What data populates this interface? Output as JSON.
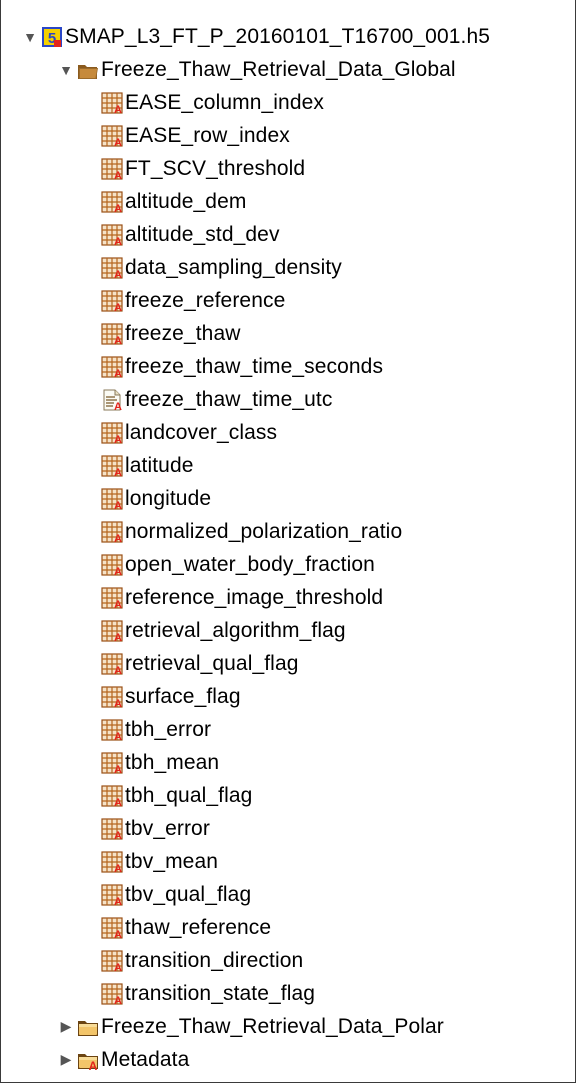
{
  "root": {
    "label": "SMAP_L3_FT_P_20160101_T16700_001.h5",
    "icon": "hdf5-file-icon",
    "expanded": true
  },
  "group_global": {
    "label": "Freeze_Thaw_Retrieval_Data_Global",
    "icon": "folder-open-icon",
    "expanded": true
  },
  "datasets": [
    {
      "label": "EASE_column_index",
      "icon": "dataset-icon"
    },
    {
      "label": "EASE_row_index",
      "icon": "dataset-icon"
    },
    {
      "label": "FT_SCV_threshold",
      "icon": "dataset-icon"
    },
    {
      "label": "altitude_dem",
      "icon": "dataset-icon"
    },
    {
      "label": "altitude_std_dev",
      "icon": "dataset-icon"
    },
    {
      "label": "data_sampling_density",
      "icon": "dataset-icon"
    },
    {
      "label": "freeze_reference",
      "icon": "dataset-icon"
    },
    {
      "label": "freeze_thaw",
      "icon": "dataset-icon"
    },
    {
      "label": "freeze_thaw_time_seconds",
      "icon": "dataset-icon"
    },
    {
      "label": "freeze_thaw_time_utc",
      "icon": "text-dataset-icon"
    },
    {
      "label": "landcover_class",
      "icon": "dataset-icon"
    },
    {
      "label": "latitude",
      "icon": "dataset-icon"
    },
    {
      "label": "longitude",
      "icon": "dataset-icon"
    },
    {
      "label": "normalized_polarization_ratio",
      "icon": "dataset-icon"
    },
    {
      "label": "open_water_body_fraction",
      "icon": "dataset-icon"
    },
    {
      "label": "reference_image_threshold",
      "icon": "dataset-icon"
    },
    {
      "label": "retrieval_algorithm_flag",
      "icon": "dataset-icon"
    },
    {
      "label": "retrieval_qual_flag",
      "icon": "dataset-icon"
    },
    {
      "label": "surface_flag",
      "icon": "dataset-icon"
    },
    {
      "label": "tbh_error",
      "icon": "dataset-icon"
    },
    {
      "label": "tbh_mean",
      "icon": "dataset-icon"
    },
    {
      "label": "tbh_qual_flag",
      "icon": "dataset-icon"
    },
    {
      "label": "tbv_error",
      "icon": "dataset-icon"
    },
    {
      "label": "tbv_mean",
      "icon": "dataset-icon"
    },
    {
      "label": "tbv_qual_flag",
      "icon": "dataset-icon"
    },
    {
      "label": "thaw_reference",
      "icon": "dataset-icon"
    },
    {
      "label": "transition_direction",
      "icon": "dataset-icon"
    },
    {
      "label": "transition_state_flag",
      "icon": "dataset-icon"
    }
  ],
  "group_polar": {
    "label": "Freeze_Thaw_Retrieval_Data_Polar",
    "icon": "folder-closed-icon",
    "expanded": false
  },
  "group_metadata": {
    "label": "Metadata",
    "icon": "folder-attribute-icon",
    "expanded": false
  },
  "colors": {
    "folder": "#e8b04a",
    "folder_dark": "#8a5a1e",
    "grid": "#b5651d",
    "attr_red": "#e3241b",
    "hdf_yellow": "#f4d000",
    "hdf_blue": "#2a47c7"
  }
}
